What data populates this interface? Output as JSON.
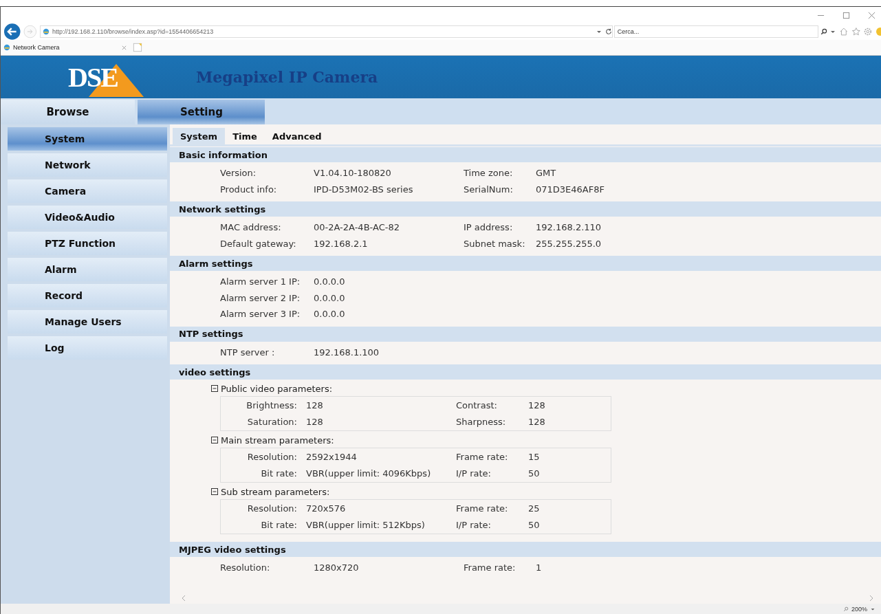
{
  "browser": {
    "url": "http://192.168.2.110/browse/index.asp?id=1554406654213",
    "search": {
      "placeholder": "Cerca..."
    },
    "tab": {
      "title": "Network Camera"
    },
    "zoom": "200%"
  },
  "header": {
    "logo": "DSE",
    "title": "Megapixel IP Camera"
  },
  "nav_tabs": [
    {
      "label": "Browse",
      "selected": false
    },
    {
      "label": "Setting",
      "selected": true
    }
  ],
  "sidebar": {
    "items": [
      {
        "label": "System",
        "selected": true
      },
      {
        "label": "Network",
        "selected": false
      },
      {
        "label": "Camera",
        "selected": false
      },
      {
        "label": "Video&Audio",
        "selected": false
      },
      {
        "label": "PTZ Function",
        "selected": false
      },
      {
        "label": "Alarm",
        "selected": false
      },
      {
        "label": "Record",
        "selected": false
      },
      {
        "label": "Manage Users",
        "selected": false
      },
      {
        "label": "Log",
        "selected": false
      }
    ]
  },
  "sub_tabs": [
    {
      "label": "System",
      "selected": true
    },
    {
      "label": "Time",
      "selected": false
    },
    {
      "label": "Advanced",
      "selected": false
    }
  ],
  "sections": [
    {
      "title": "Basic information",
      "kind": "pairs",
      "rows": [
        [
          {
            "label": "Version:",
            "value": "V1.04.10-180820"
          },
          {
            "label": "Time zone:",
            "value": "GMT"
          }
        ],
        [
          {
            "label": "Product info:",
            "value": "IPD-D53M02-BS series"
          },
          {
            "label": "SerialNum:",
            "value": "071D3E46AF8F"
          }
        ]
      ]
    },
    {
      "title": "Network settings",
      "kind": "pairs",
      "rows": [
        [
          {
            "label": "MAC address:",
            "value": "00-2A-2A-4B-AC-82"
          },
          {
            "label": "IP address:",
            "value": "192.168.2.110"
          }
        ],
        [
          {
            "label": "Default gateway:",
            "value": "192.168.2.1"
          },
          {
            "label": "Subnet mask:",
            "value": "255.255.255.0"
          }
        ]
      ]
    },
    {
      "title": "Alarm settings",
      "kind": "pairs",
      "rows": [
        [
          {
            "label": "Alarm server 1 IP:",
            "value": "0.0.0.0"
          }
        ],
        [
          {
            "label": "Alarm server 2 IP:",
            "value": "0.0.0.0"
          }
        ],
        [
          {
            "label": "Alarm server 3 IP:",
            "value": "0.0.0.0"
          }
        ]
      ]
    },
    {
      "title": "NTP settings",
      "kind": "pairs",
      "rows": [
        [
          {
            "label": "NTP server :",
            "value": "192.168.1.100"
          }
        ]
      ]
    },
    {
      "title": "video settings",
      "kind": "groups",
      "groups": [
        {
          "title": "Public video parameters:",
          "expanded": true,
          "rows": [
            [
              {
                "label": "Brightness:",
                "value": "128"
              },
              {
                "label": "Contrast:",
                "value": "128"
              }
            ],
            [
              {
                "label": "Saturation:",
                "value": "128"
              },
              {
                "label": "Sharpness:",
                "value": "128"
              }
            ]
          ]
        },
        {
          "title": "Main stream parameters:",
          "expanded": true,
          "rows": [
            [
              {
                "label": "Resolution:",
                "value": "2592x1944"
              },
              {
                "label": "Frame rate:",
                "value": "15"
              }
            ],
            [
              {
                "label": "Bit rate:",
                "value": "VBR(upper limit: 4096Kbps)"
              },
              {
                "label": "I/P rate:",
                "value": "50"
              }
            ]
          ]
        },
        {
          "title": "Sub stream parameters:",
          "expanded": true,
          "rows": [
            [
              {
                "label": "Resolution:",
                "value": "720x576"
              },
              {
                "label": "Frame rate:",
                "value": "25"
              }
            ],
            [
              {
                "label": "Bit rate:",
                "value": "VBR(upper limit: 512Kbps)"
              },
              {
                "label": "I/P rate:",
                "value": "50"
              }
            ]
          ]
        }
      ]
    },
    {
      "title": "MJPEG video settings",
      "kind": "pairs",
      "rows": [
        [
          {
            "label": "Resolution:",
            "value": "1280x720"
          },
          {
            "label": "Frame rate:",
            "value": "1"
          }
        ]
      ]
    }
  ]
}
